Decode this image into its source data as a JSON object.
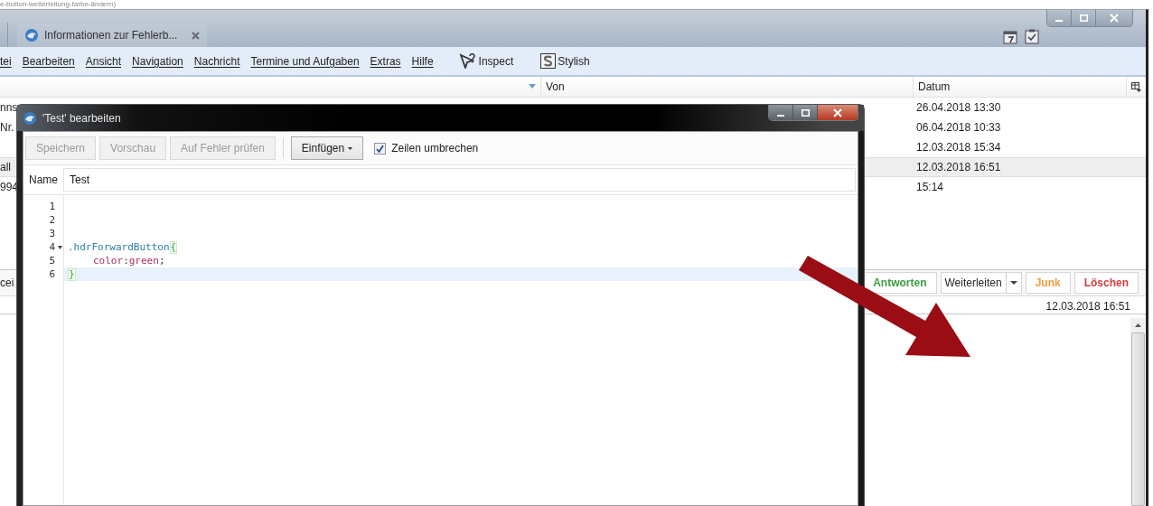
{
  "page_title_fragment": "e-button-weiterleitung-farbe-ändern)",
  "main_window": {
    "tabs": [
      {
        "label": "Informationen zur Fehlerb...",
        "selected": true
      }
    ],
    "menu": [
      {
        "label": "tei"
      },
      {
        "label": "Bearbeiten"
      },
      {
        "label": "Ansicht"
      },
      {
        "label": "Navigation"
      },
      {
        "label": "Nachricht"
      },
      {
        "label": "Termine und Aufgaben"
      },
      {
        "label": "Extras"
      },
      {
        "label": "Hilfe"
      }
    ],
    "toolbar_buttons": [
      {
        "label": "Inspect",
        "kind": "inspect"
      },
      {
        "label": "Stylish",
        "kind": "stylish"
      }
    ],
    "message_list": {
      "columns": [
        "Von",
        "Datum"
      ],
      "rows": [
        {
          "column_1": "nns",
          "datum": "26.04.2018 13:30",
          "selected": false
        },
        {
          "column_1": "Nr.",
          "datum": "06.04.2018 10:33",
          "selected": false
        },
        {
          "datum": "12.03.2018 15:34",
          "selected": false
        },
        {
          "column_1": "all",
          "datum": "12.03.2018 16:51",
          "selected": true
        },
        {
          "column_1": "994",
          "datum": "15:14",
          "selected": false
        }
      ]
    },
    "header_pane": {
      "column_1": "cei",
      "buttons": [
        {
          "label": "Antworten",
          "color": "#3f9f3f",
          "kind": "plain"
        },
        {
          "label": "Weiterleiten",
          "color": "#222222",
          "kind": "split"
        },
        {
          "label": "Junk",
          "color": "#f0a040",
          "kind": "plain"
        },
        {
          "label": "Löschen",
          "color": "#d04040",
          "kind": "plain"
        }
      ],
      "date": "12.03.2018 16:51"
    }
  },
  "editor_dialog": {
    "title": "'Test' bearbeiten",
    "toolbar": [
      {
        "label": "Speichern",
        "kind": "button",
        "disabled": true
      },
      {
        "label": "Vorschau",
        "kind": "button",
        "disabled": true
      },
      {
        "label": "Auf Fehler prüfen",
        "kind": "button",
        "disabled": true
      },
      {
        "label": "Einfügen",
        "kind": "menu",
        "disabled": false
      },
      {
        "label": "Zeilen umbrechen",
        "kind": "checkbox",
        "checked": true
      }
    ],
    "name_label": "Name",
    "name_value": "Test",
    "code_lines": [
      {
        "number": "1"
      },
      {
        "number": "2"
      },
      {
        "number": "3"
      },
      {
        "number": "4",
        "foldable": true,
        "tokens": [
          {
            "kind": "selector",
            "text": ".hdrForwardButton"
          },
          {
            "kind": "brace",
            "text": "{"
          }
        ]
      },
      {
        "number": "5",
        "indented": true,
        "tokens": [
          {
            "kind": "property",
            "text": "color"
          },
          {
            "kind": "punct",
            "text": ":"
          },
          {
            "kind": "value",
            "text": "green"
          },
          {
            "kind": "punct",
            "text": ";"
          }
        ]
      },
      {
        "number": "6",
        "highlighted": true,
        "tokens": [
          {
            "kind": "brace",
            "text": "}"
          }
        ]
      }
    ]
  }
}
